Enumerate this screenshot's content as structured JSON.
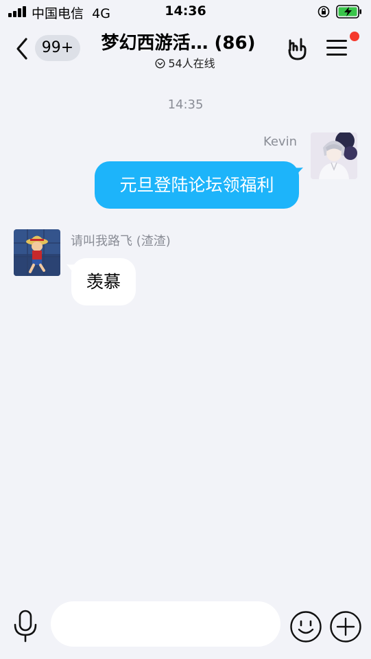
{
  "status_bar": {
    "carrier": "中国电信",
    "network": "4G",
    "time": "14:36"
  },
  "header": {
    "back_badge": "99+",
    "title": "梦幻西游活… (86)",
    "online_count": "54",
    "online_label": "人在线"
  },
  "messages": {
    "timestamp": "14:35",
    "outgoing": {
      "sender": "Kevin",
      "text": "元旦登陆论坛领福利",
      "color": "#1db4fa"
    },
    "incoming": {
      "sender": "请叫我路飞 (渣渣)",
      "text": "羡慕"
    }
  },
  "input_bar": {
    "placeholder": ""
  },
  "icons": {
    "back": "chevron-left-icon",
    "rock": "rock-hand-icon",
    "menu": "menu-icon",
    "mic": "microphone-icon",
    "emoji": "smiley-icon",
    "plus": "plus-icon"
  }
}
